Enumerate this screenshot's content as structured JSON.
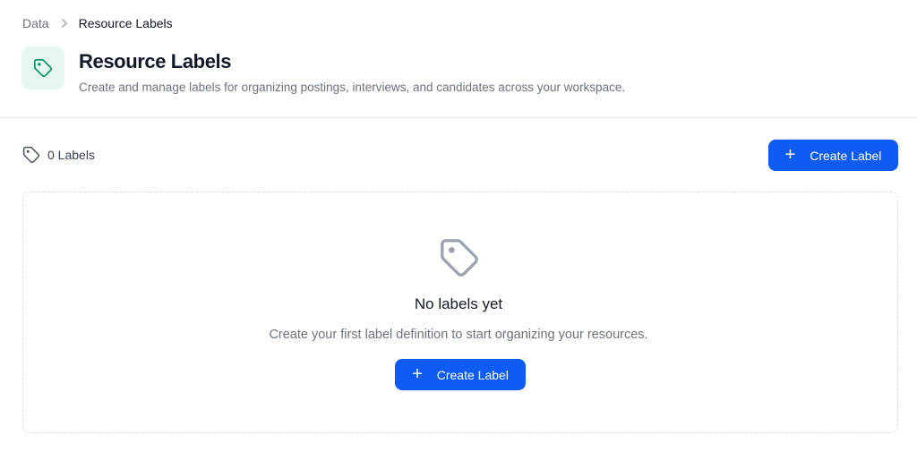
{
  "breadcrumb": {
    "parent": "Data",
    "current": "Resource Labels"
  },
  "header": {
    "icon": "tag-icon",
    "title": "Resource Labels",
    "subtitle": "Create and manage labels for organizing postings, interviews, and candidates across your workspace."
  },
  "toolbar": {
    "count_label": "0 Labels",
    "create_label": "Create Label"
  },
  "empty_state": {
    "icon": "tag-icon",
    "title": "No labels yet",
    "description": "Create your first label definition to start organizing your resources.",
    "create_label": "Create Label"
  },
  "colors": {
    "accent": "#0e5cf4",
    "icon_tile_bg": "#e7f6ef",
    "icon_tile_fg": "#159a6b"
  }
}
